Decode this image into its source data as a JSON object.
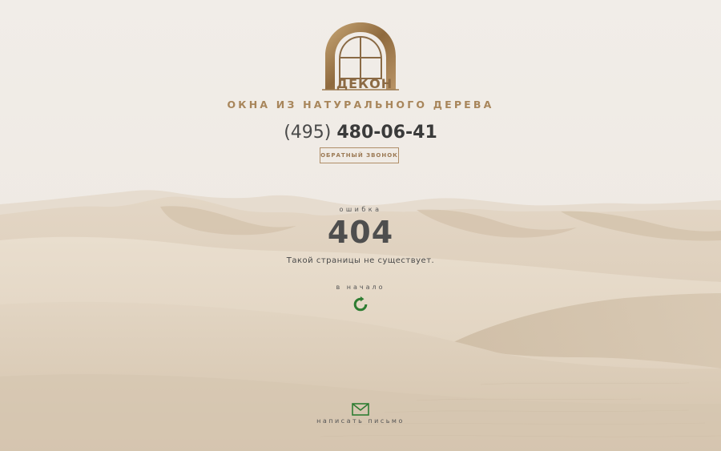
{
  "brand": {
    "name": "ДЕКОН",
    "tagline": "ОКНА ИЗ НАТУРАЛЬНОГО ДЕРЕВА"
  },
  "contact": {
    "phone_code": "(495)",
    "phone_number": "480-06-41",
    "callback_label": "ОБРАТНЫЙ ЗВОНОК"
  },
  "error": {
    "label": "ошибка",
    "code": "404",
    "message": "Такой страницы не существует."
  },
  "navigation": {
    "home_label": "в начало",
    "home_icon": "refresh-icon"
  },
  "mail": {
    "label": "написать письмо",
    "icon": "envelope-icon"
  },
  "colors": {
    "accent_gold": "#a8865b",
    "icon_green": "#2e7d32",
    "sky": "#f0ece7",
    "sand": "#ddd0be"
  }
}
